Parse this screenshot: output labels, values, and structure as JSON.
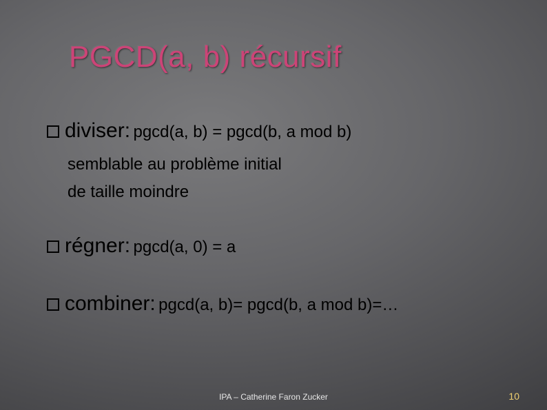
{
  "title": "PGCD(a, b) récursif",
  "bullets": {
    "b1": {
      "term": "diviser:",
      "expr": "pgcd(a, b) = pgcd(b, a mod b)",
      "sub1": "semblable au problème initial",
      "sub2": "de taille moindre"
    },
    "b2": {
      "term": "régner:",
      "expr": "pgcd(a, 0) = a"
    },
    "b3": {
      "term": "combiner:",
      "expr": "pgcd(a, b)= pgcd(b, a mod b)=…"
    }
  },
  "footer": {
    "center": "IPA – Catherine Faron Zucker",
    "page": "10"
  }
}
